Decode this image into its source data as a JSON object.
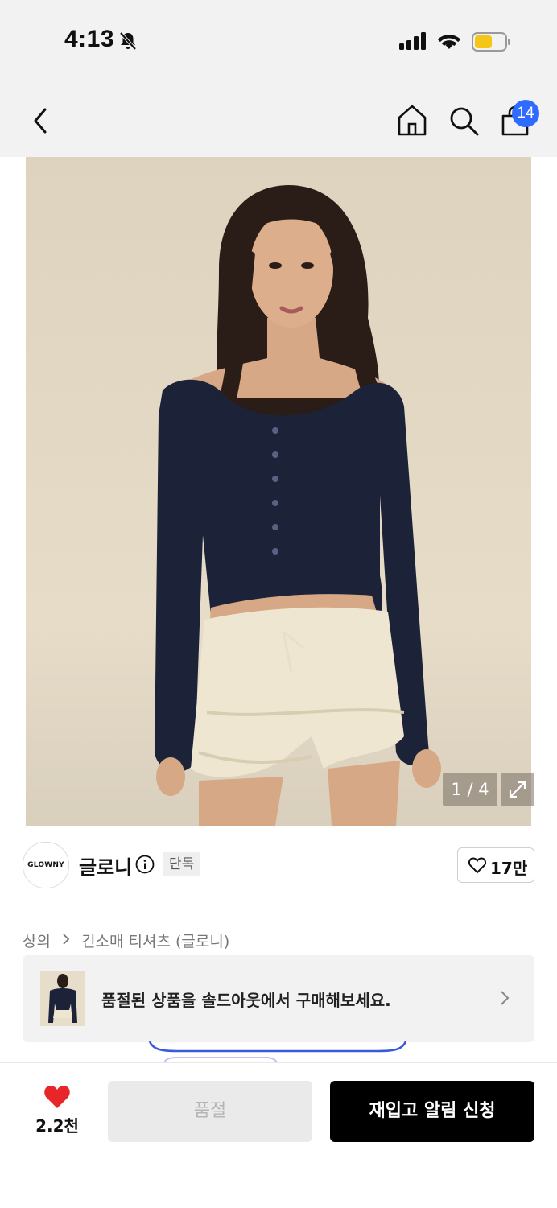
{
  "status_bar": {
    "time": "4:13",
    "icons": [
      "bell-muted-icon",
      "cellular-signal-icon",
      "wifi-icon",
      "battery-icon"
    ],
    "battery_color": "#f5c518"
  },
  "nav": {
    "icons": [
      "back-chevron-icon",
      "home-icon",
      "search-icon",
      "shopping-bag-icon"
    ],
    "cart_count": "14",
    "badge_color": "#2f6bff"
  },
  "gallery": {
    "counter": "1 / 4",
    "expand_icon": "expand-arrows-icon",
    "image": "model wearing navy off-shoulder long sleeve top and cream ruffled shorts"
  },
  "brand": {
    "logo_text": "GLOWNY",
    "name": "글로니",
    "badge": "단독",
    "likes": "17만"
  },
  "breadcrumb": {
    "category": "상의",
    "product": "긴소매 티셔츠 (글로니)"
  },
  "soldout_banner": {
    "text": "품절된 상품을 솔드아웃에서 구매해보세요."
  },
  "bottom_bar": {
    "wish_count": "2.2천",
    "heart_color": "#e8262a",
    "soldout_label": "품절",
    "restock_label": "재입고 알림 신청"
  }
}
